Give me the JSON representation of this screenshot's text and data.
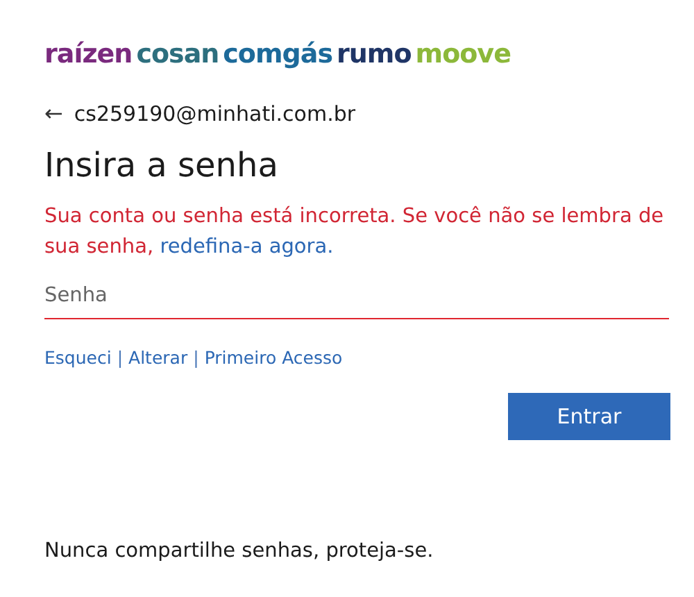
{
  "logos": [
    {
      "text": "raízen",
      "color": "#7a2a7e"
    },
    {
      "text": "cosan",
      "color": "#2d6f7e"
    },
    {
      "text": "comgás",
      "color": "#1d6a9a"
    },
    {
      "text": "rumo",
      "color": "#1f3566"
    },
    {
      "text": "moove",
      "color": "#8cb83a"
    }
  ],
  "account": {
    "back_icon": "←",
    "email": "cs259190@minhati.com.br"
  },
  "title": "Insira a senha",
  "error": {
    "text": "Sua conta ou senha está incorreta. Se você não se lembra de sua senha, ",
    "link": "redefina-a agora."
  },
  "password_field": {
    "placeholder": "Senha",
    "invalid": true
  },
  "links": [
    {
      "kind": "link",
      "text": "Esqueci"
    },
    {
      "kind": "separator",
      "text": "|"
    },
    {
      "kind": "link",
      "text": "Alterar"
    },
    {
      "kind": "separator",
      "text": "|"
    },
    {
      "kind": "link",
      "text": "Primeiro Acesso"
    }
  ],
  "buttons": [
    {
      "label": "Entrar"
    }
  ],
  "footer": "Nunca compartilhe senhas, proteja-se."
}
